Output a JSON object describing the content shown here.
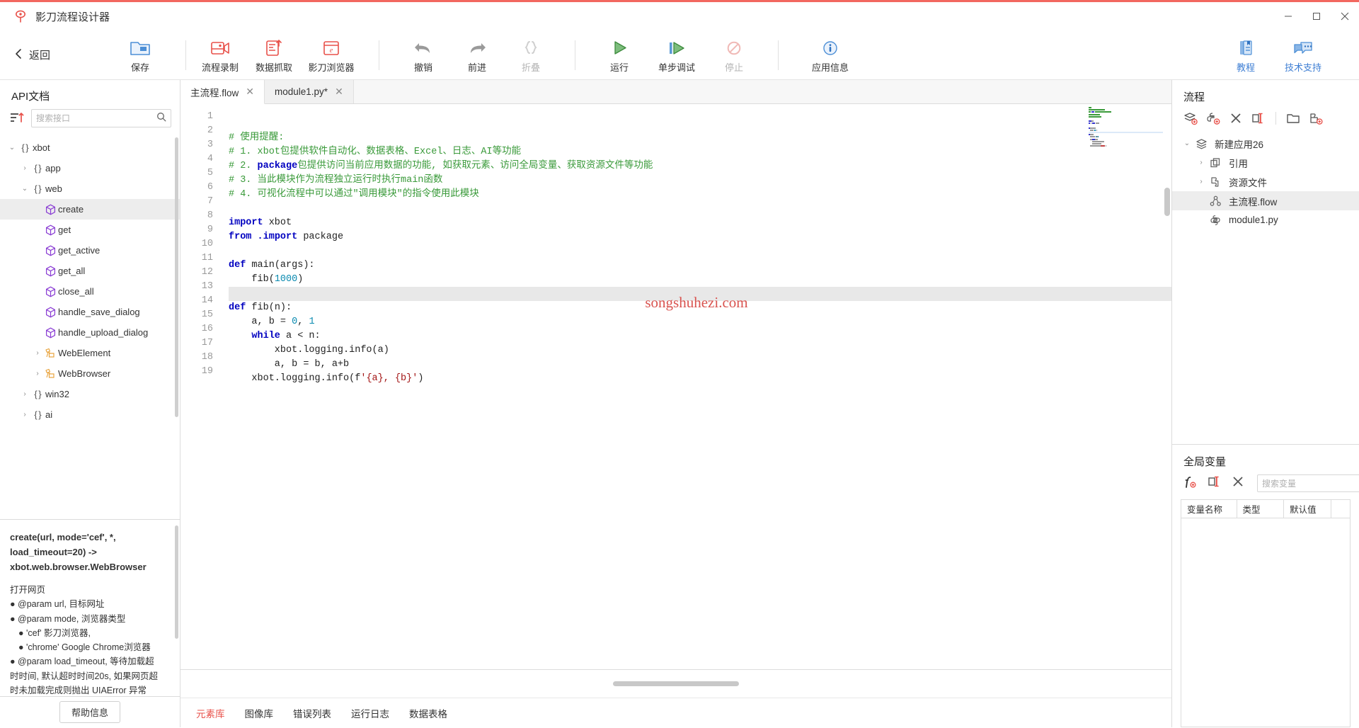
{
  "window": {
    "title": "影刀流程设计器",
    "logo_icon": "xbot-logo-icon",
    "minimize": "—",
    "maximize": "❐",
    "close": "✕"
  },
  "toolbar": {
    "back_label": "返回",
    "back_icon": "chevron-left-icon",
    "items": [
      {
        "label": "保存",
        "icon": "save-folder-icon",
        "disabled": false
      },
      {
        "label": "流程录制",
        "icon": "record-flow-icon",
        "disabled": false
      },
      {
        "label": "数据抓取",
        "icon": "data-capture-icon",
        "disabled": false
      },
      {
        "label": "影刀浏览器",
        "icon": "xbot-browser-icon",
        "disabled": false
      },
      {
        "label": "撤销",
        "icon": "undo-arrow-icon",
        "disabled": false
      },
      {
        "label": "前进",
        "icon": "redo-arrow-icon",
        "disabled": false
      },
      {
        "label": "折叠",
        "icon": "braces-collapse-icon",
        "disabled": true
      },
      {
        "label": "运行",
        "icon": "run-play-icon",
        "disabled": false
      },
      {
        "label": "单步调试",
        "icon": "step-debug-icon",
        "disabled": false
      },
      {
        "label": "停止",
        "icon": "stop-forbidden-icon",
        "disabled": true
      },
      {
        "label": "应用信息",
        "icon": "info-circle-icon",
        "disabled": false
      }
    ],
    "right_items": [
      {
        "label": "教程",
        "icon": "tutorial-book-icon"
      },
      {
        "label": "技术支持",
        "icon": "support-chat-icon"
      }
    ]
  },
  "api_panel": {
    "title": "API文档",
    "sort_icon": "sort-ascending-icon",
    "search_placeholder": "搜索接口",
    "search_value": "",
    "search_icon": "search-icon",
    "tree": [
      {
        "label": "xbot",
        "depth": 0,
        "type": "package",
        "expanded": true,
        "selected": false
      },
      {
        "label": "app",
        "depth": 1,
        "type": "package",
        "expanded": false,
        "selected": false
      },
      {
        "label": "web",
        "depth": 1,
        "type": "package",
        "expanded": true,
        "selected": false
      },
      {
        "label": "create",
        "depth": 2,
        "type": "method",
        "expanded": null,
        "selected": true
      },
      {
        "label": "get",
        "depth": 2,
        "type": "method",
        "expanded": null,
        "selected": false
      },
      {
        "label": "get_active",
        "depth": 2,
        "type": "method",
        "expanded": null,
        "selected": false
      },
      {
        "label": "get_all",
        "depth": 2,
        "type": "method",
        "expanded": null,
        "selected": false
      },
      {
        "label": "close_all",
        "depth": 2,
        "type": "method",
        "expanded": null,
        "selected": false
      },
      {
        "label": "handle_save_dialog",
        "depth": 2,
        "type": "method",
        "expanded": null,
        "selected": false
      },
      {
        "label": "handle_upload_dialog",
        "depth": 2,
        "type": "method",
        "expanded": null,
        "selected": false
      },
      {
        "label": "WebElement",
        "depth": 2,
        "type": "class",
        "expanded": false,
        "selected": false
      },
      {
        "label": "WebBrowser",
        "depth": 2,
        "type": "class",
        "expanded": false,
        "selected": false
      },
      {
        "label": "win32",
        "depth": 1,
        "type": "package",
        "expanded": false,
        "selected": false
      },
      {
        "label": "ai",
        "depth": 1,
        "type": "package",
        "expanded": false,
        "selected": false
      }
    ],
    "doc": {
      "signature": "create(url, mode='cef', *, load_timeout=20) -> xbot.web.browser.WebBrowser",
      "summary": "打开网页",
      "lines": [
        {
          "text": "● @param url, 目标网址",
          "indent": 0
        },
        {
          "text": "● @param mode, 浏览器类型",
          "indent": 0
        },
        {
          "text": "● 'cef' 影刀浏览器,",
          "indent": 1
        },
        {
          "text": "● 'chrome' Google Chrome浏览器",
          "indent": 1
        },
        {
          "text": "● @param load_timeout, 等待加载超",
          "indent": 0
        },
        {
          "text": "时时间, 默认超时时间20s, 如果网页超",
          "indent": 0
        },
        {
          "text": "时未加载完成则抛出 UIAError 异常",
          "indent": 0
        }
      ]
    },
    "help_button": "帮助信息"
  },
  "editor": {
    "tabs": [
      {
        "label": "主流程.flow",
        "active": true,
        "close_icon": "close-icon",
        "modified": false
      },
      {
        "label": "module1.py*",
        "active": false,
        "close_icon": "close-icon",
        "modified": true
      }
    ],
    "watermark": "songshuhezi.com",
    "highlighted_line": 12,
    "lines": [
      {
        "n": 1,
        "tokens": [
          {
            "t": "# 使用提醒:",
            "c": "cm"
          }
        ]
      },
      {
        "n": 2,
        "tokens": [
          {
            "t": "# 1. xbot包提供软件自动化、数据表格、Excel、日志、AI等功能",
            "c": "cm"
          }
        ]
      },
      {
        "n": 3,
        "tokens": [
          {
            "t": "# 2. ",
            "c": "cm"
          },
          {
            "t": "package",
            "c": "kw"
          },
          {
            "t": "包提供访问当前应用数据的功能, 如获取元素、访问全局变量、获取资源文件等功能",
            "c": "cm"
          }
        ]
      },
      {
        "n": 4,
        "tokens": [
          {
            "t": "# 3. 当此模块作为流程独立运行时执行main函数",
            "c": "cm"
          }
        ]
      },
      {
        "n": 5,
        "tokens": [
          {
            "t": "# 4. 可视化流程中可以通过\"调用模块\"的指令使用此模块",
            "c": "cm"
          }
        ]
      },
      {
        "n": 6,
        "tokens": []
      },
      {
        "n": 7,
        "tokens": [
          {
            "t": "import",
            "c": "kw"
          },
          {
            "t": " xbot",
            "c": "fn"
          }
        ]
      },
      {
        "n": 8,
        "tokens": [
          {
            "t": "from",
            "c": "kw"
          },
          {
            "t": " ",
            "c": "fn"
          },
          {
            "t": ".import",
            "c": "kw"
          },
          {
            "t": " package",
            "c": "fn"
          }
        ]
      },
      {
        "n": 9,
        "tokens": []
      },
      {
        "n": 10,
        "tokens": [
          {
            "t": "def",
            "c": "kw"
          },
          {
            "t": " main(args):",
            "c": "fn"
          }
        ]
      },
      {
        "n": 11,
        "tokens": [
          {
            "t": "    fib(",
            "c": "fn"
          },
          {
            "t": "1000",
            "c": "num"
          },
          {
            "t": ")",
            "c": "fn"
          }
        ]
      },
      {
        "n": 12,
        "tokens": []
      },
      {
        "n": 13,
        "tokens": [
          {
            "t": "def",
            "c": "kw"
          },
          {
            "t": " fib(n):",
            "c": "fn"
          }
        ]
      },
      {
        "n": 14,
        "tokens": [
          {
            "t": "    a, b = ",
            "c": "fn"
          },
          {
            "t": "0",
            "c": "num"
          },
          {
            "t": ", ",
            "c": "fn"
          },
          {
            "t": "1",
            "c": "num"
          }
        ]
      },
      {
        "n": 15,
        "tokens": [
          {
            "t": "    ",
            "c": "fn"
          },
          {
            "t": "while",
            "c": "kw"
          },
          {
            "t": " a < n:",
            "c": "fn"
          }
        ]
      },
      {
        "n": 16,
        "tokens": [
          {
            "t": "        xbot.logging.info(a)",
            "c": "fn"
          }
        ]
      },
      {
        "n": 17,
        "tokens": [
          {
            "t": "        a, b = b, a+b",
            "c": "fn"
          }
        ]
      },
      {
        "n": 18,
        "tokens": [
          {
            "t": "    xbot.logging.info(f",
            "c": "fn"
          },
          {
            "t": "'{a}, {b}'",
            "c": "str"
          },
          {
            "t": ")",
            "c": "fn"
          }
        ]
      },
      {
        "n": 19,
        "tokens": []
      }
    ],
    "bottom_tabs": [
      {
        "label": "元素库",
        "active": true
      },
      {
        "label": "图像库",
        "active": false
      },
      {
        "label": "错误列表",
        "active": false
      },
      {
        "label": "运行日志",
        "active": false
      },
      {
        "label": "数据表格",
        "active": false
      }
    ]
  },
  "flow_panel": {
    "title": "流程",
    "icons": [
      {
        "name": "add-flow-icon",
        "glyph": "layers-plus"
      },
      {
        "name": "add-module-icon",
        "glyph": "python-plus"
      },
      {
        "name": "delete-icon",
        "glyph": "x"
      },
      {
        "name": "rename-icon",
        "glyph": "rename"
      },
      {
        "name": "new-folder-icon",
        "glyph": "folder"
      },
      {
        "name": "add-resource-icon",
        "glyph": "puzzle-plus"
      }
    ],
    "tree": [
      {
        "label": "新建应用26",
        "depth": 0,
        "icon": "app-layers-icon",
        "expanded": true,
        "selected": false
      },
      {
        "label": "引用",
        "depth": 1,
        "icon": "reference-icon",
        "expanded": false,
        "selected": false
      },
      {
        "label": "资源文件",
        "depth": 1,
        "icon": "resource-icon",
        "expanded": false,
        "selected": false
      },
      {
        "label": "主流程.flow",
        "depth": 1,
        "icon": "flow-icon",
        "expanded": null,
        "selected": true
      },
      {
        "label": "module1.py",
        "depth": 1,
        "icon": "python-file-icon",
        "expanded": null,
        "selected": false
      }
    ]
  },
  "global_vars": {
    "title": "全局变量",
    "icons": [
      {
        "name": "add-variable-icon",
        "glyph": "fx-plus"
      },
      {
        "name": "rename-variable-icon",
        "glyph": "rename"
      },
      {
        "name": "delete-variable-icon",
        "glyph": "x"
      }
    ],
    "search_placeholder": "搜索变量",
    "search_value": "",
    "search_icon": "search-icon",
    "columns": [
      "变量名称",
      "类型",
      "默认值",
      ""
    ],
    "rows": []
  },
  "colors": {
    "accent_red": "#f2675f",
    "accent_blue": "#3f7fd4",
    "comment_green": "#3a9a3a",
    "keyword_blue": "#0000c0",
    "string_red": "#a31515",
    "number_teal": "#0a8ab0",
    "run_green": "#5cab5c",
    "purple_icon": "#8b3fd4",
    "orange_icon": "#e8a33d"
  }
}
